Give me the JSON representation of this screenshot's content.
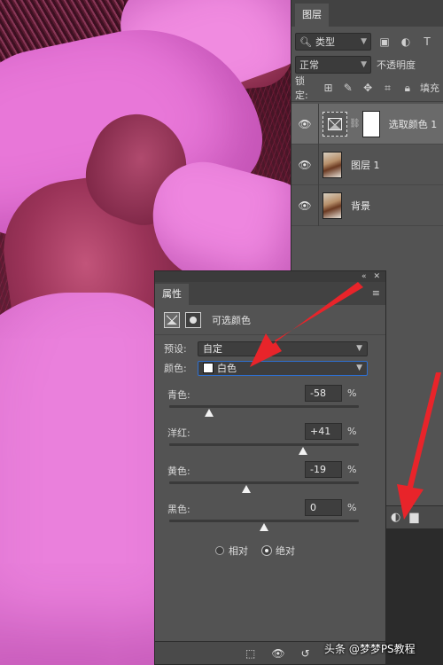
{
  "layers_panel": {
    "tab": "图层",
    "filter": {
      "kind_label": "类型"
    },
    "blend_mode": "正常",
    "opacity_label": "不透明度",
    "lock_label": "锁定:",
    "fill_label": "填充",
    "layers": [
      {
        "name": "选取颜色 1",
        "selected": true,
        "type": "adjustment"
      },
      {
        "name": "图层 1",
        "selected": false,
        "type": "pixel"
      },
      {
        "name": "背景",
        "selected": false,
        "type": "pixel"
      }
    ]
  },
  "properties_panel": {
    "tab": "属性",
    "title": "可选颜色",
    "preset_label": "预设:",
    "preset_value": "自定",
    "color_label": "颜色:",
    "color_value": "白色",
    "sliders": [
      {
        "label": "青色:",
        "value": "-58",
        "pct": "%",
        "norm": -58
      },
      {
        "label": "洋红:",
        "value": "+41",
        "pct": "%",
        "norm": 41
      },
      {
        "label": "黄色:",
        "value": "-19",
        "pct": "%",
        "norm": -19
      },
      {
        "label": "黑色:",
        "value": "0",
        "pct": "%",
        "norm": 0
      }
    ],
    "radio_relative": "相对",
    "radio_absolute": "绝对",
    "selected_method": "absolute"
  },
  "colors": {
    "arrow": "#e8242a",
    "panel": "#535353",
    "shirt": "#ea80dc"
  },
  "watermark": "头条 @梦梦PS教程"
}
